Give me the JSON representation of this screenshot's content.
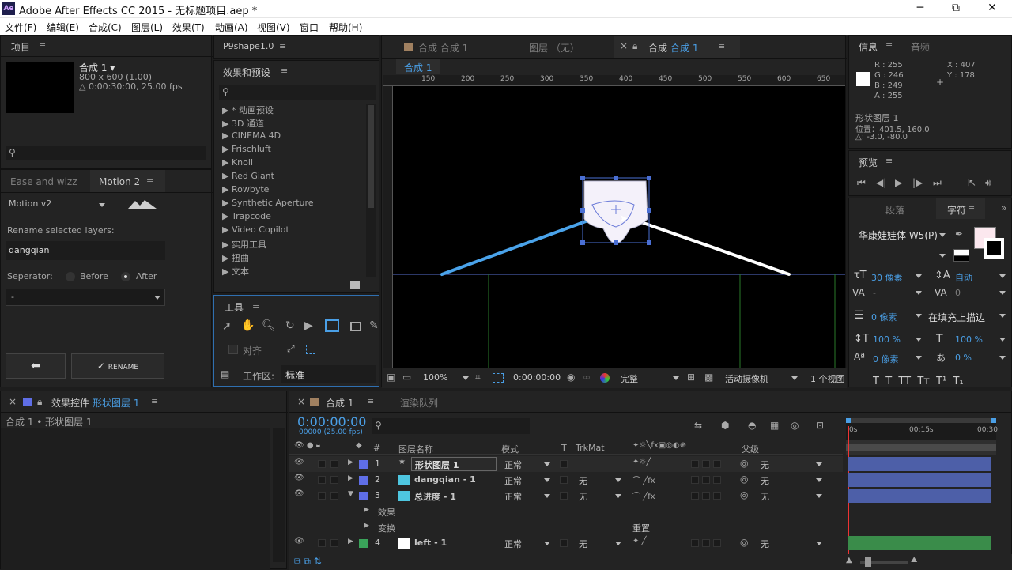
{
  "title": "Adobe After Effects CC 2015 - 无标题项目.aep *",
  "window": {
    "minimize": "─",
    "maximize": "⧉",
    "close": "✕"
  },
  "menu": [
    "文件(F)",
    "编辑(E)",
    "合成(C)",
    "图层(L)",
    "效果(T)",
    "动画(A)",
    "视图(V)",
    "窗口",
    "帮助(H)"
  ],
  "project": {
    "tab": "项目",
    "comp_name": "合成 1 ▾",
    "comp_size": "800 x 600 (1.00)",
    "comp_dur": "△ 0:00:30:00, 25.00 fps"
  },
  "motion": {
    "tab1": "Ease and wizz",
    "tab2": "Motion 2",
    "preset": "Motion v2",
    "rename_label": "Rename selected layers:",
    "name_value": "dangqian",
    "separator": "Seperator:",
    "before": "Before",
    "after": "After",
    "sep_value": "-",
    "rename_btn": "RENAME"
  },
  "p9": {
    "tab": "P9shape1.0"
  },
  "effects": {
    "tab": "效果和预设",
    "items": [
      "* 动画预设",
      "3D 通道",
      "CINEMA 4D",
      "Frischluft",
      "Knoll",
      "Red Giant",
      "Rowbyte",
      "Synthetic Aperture",
      "Trapcode",
      "Video Copilot",
      "实用工具",
      "扭曲",
      "文本"
    ]
  },
  "tools": {
    "tab": "工具",
    "snap": "对齐",
    "workspace_label": "工作区:",
    "workspace": "标准"
  },
  "viewer": {
    "tab_a": "合成 合成 1",
    "tab_b": "图层 （无）",
    "tab_c_prefix": "合成",
    "tab_c_name": "合成 1",
    "crumb": "合成 1",
    "ruler": [
      "150",
      "200",
      "250",
      "300",
      "350",
      "400",
      "450",
      "500",
      "550",
      "600",
      "650"
    ],
    "zoom": "100%",
    "time": "0:00:00:00",
    "quality": "完整",
    "camera": "活动摄像机",
    "views": "1 个视图"
  },
  "info": {
    "tab": "信息",
    "tab2": "音频",
    "R": "R : 255",
    "G": "G : 246",
    "B": "B : 249",
    "A": "A : 255",
    "X": "X : 407",
    "Y": "Y : 178",
    "layer": "形状图层 1",
    "pos": "位置：401.5, 160.0",
    "delta": "△: -3.0, -80.0"
  },
  "preview": {
    "tab": "预览"
  },
  "character": {
    "tab1": "段落",
    "tab2": "字符",
    "font": "华康娃娃体 W5(P)",
    "style": "-",
    "size": "30 像素",
    "leading": "自动",
    "kerning": "-",
    "tracking": "0",
    "stroke": "0 像素",
    "stroke_mode": "在填充上描边",
    "vscale": "100 %",
    "hscale": "100 %",
    "baseline": "0 像素",
    "tsume": "0 %"
  },
  "effect_controls": {
    "tab_prefix": "效果控件",
    "tab_layer": "形状图层 1",
    "crumb": "合成 1 • 形状图层 1"
  },
  "timeline": {
    "tab": "合成 1",
    "tab2": "渲染队列",
    "timecode": "0:00:00:00",
    "frames": "00000 (25.00 fps)",
    "col_num": "#",
    "col_name": "图层名称",
    "col_mode": "模式",
    "col_t": "T",
    "col_trkmat": "TrkMat",
    "col_parent": "父级",
    "time_0": "0s",
    "time_15": "00:15s",
    "time_30": "00:30",
    "layers": [
      {
        "num": "1",
        "name": "形状图层 1",
        "mode": "正常",
        "trk": "",
        "parent": "无",
        "color": "#5f6ee6"
      },
      {
        "num": "2",
        "name": "dangqian - 1",
        "mode": "正常",
        "trk": "无",
        "parent": "无",
        "color": "#5f6ee6"
      },
      {
        "num": "3",
        "name": "总进度 - 1",
        "mode": "正常",
        "trk": "无",
        "parent": "无",
        "color": "#5f6ee6"
      },
      {
        "num": "4",
        "name": "left - 1",
        "mode": "正常",
        "trk": "无",
        "parent": "无",
        "color": "#3aa35a"
      }
    ],
    "effects_row": "效果",
    "transform_row": "变换",
    "reset": "重置"
  },
  "colors": {
    "accent": "#4a9fe6",
    "layer_bar": "#4d5fa8",
    "green_bar": "#3a8c4a"
  }
}
